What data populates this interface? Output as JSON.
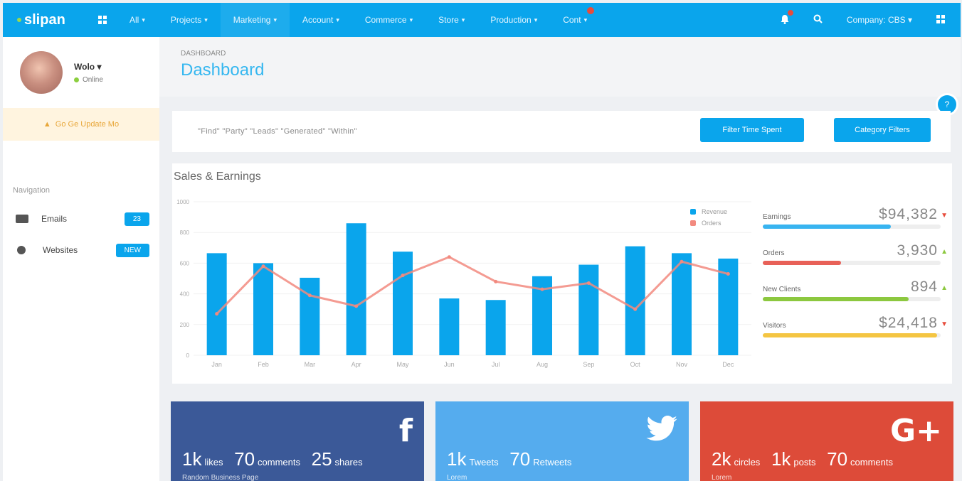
{
  "topbar": {
    "logo": "slipan",
    "menu": [
      {
        "label": "All"
      },
      {
        "label": "Projects"
      },
      {
        "label": "Marketing"
      },
      {
        "label": "Account"
      },
      {
        "label": "Commerce"
      },
      {
        "label": "Store"
      },
      {
        "label": "Production"
      },
      {
        "label": "Cont"
      }
    ],
    "company": "Company: CBS"
  },
  "user": {
    "name": "Wolo",
    "status": "Online"
  },
  "sidebar": {
    "warning": "Go Ge Update Mo",
    "nav_title": "Navigation",
    "items": [
      {
        "label": "Emails",
        "badge": "23"
      },
      {
        "label": "Websites",
        "badge": "NEW"
      }
    ]
  },
  "header": {
    "crumb": "DASHBOARD",
    "title": "Dashboard"
  },
  "filter": {
    "text": "\"Find\" \"Party\" \"Leads\" \"Generated\" \"Within\"",
    "time_button": "Filter Time Spent",
    "category_button": "Category Filters"
  },
  "sales_card": {
    "title": "Sales & Earnings"
  },
  "colors": {
    "primary": "#0aa5ec",
    "orders": "#f28a7f",
    "facebook": "#3b5998",
    "twitter": "#55acee",
    "google": "#dd4b39"
  },
  "chart_data": {
    "type": "bar",
    "categories": [
      "Jan",
      "Feb",
      "Mar",
      "Apr",
      "May",
      "Jun",
      "Jul",
      "Aug",
      "Sep",
      "Oct",
      "Nov",
      "Dec"
    ],
    "series": [
      {
        "name": "Revenue",
        "type": "bar",
        "values": [
          665,
          600,
          505,
          860,
          675,
          370,
          360,
          515,
          590,
          710,
          665,
          630
        ]
      },
      {
        "name": "Orders",
        "type": "line",
        "values": [
          270,
          580,
          390,
          320,
          520,
          640,
          480,
          430,
          470,
          300,
          610,
          530
        ]
      }
    ],
    "yticks": [
      "0",
      "200",
      "400",
      "600",
      "800",
      "1000"
    ],
    "ylim": [
      0,
      1000
    ]
  },
  "stats": [
    {
      "label": "Earnings",
      "value": "$94,382",
      "trend": "down",
      "fill": 0.72,
      "color": "#38b4f0"
    },
    {
      "label": "Orders",
      "value": "3,930",
      "trend": "up",
      "fill": 0.44,
      "color": "#e86158"
    },
    {
      "label": "New Clients",
      "value": "894",
      "trend": "up",
      "fill": 0.82,
      "color": "#8cc83f"
    },
    {
      "label": "Visitors",
      "value": "$24,418",
      "trend": "down",
      "fill": 0.98,
      "color": "#f4c542"
    }
  ],
  "social": {
    "facebook": {
      "likes": "1k",
      "likes_label": "likes",
      "comments": "70",
      "comments_label": "comments",
      "shares": "25",
      "shares_label": "shares",
      "sub": "Random Business Page"
    },
    "twitter": {
      "tweets": "1k",
      "tweets_label": "Tweets",
      "retweets": "70",
      "retweets_label": "Retweets",
      "sub": "Lorem"
    },
    "google": {
      "circles": "2k",
      "circles_label": "circles",
      "posts": "1k",
      "posts_label": "posts",
      "comments": "70",
      "comments_label": "comments",
      "sub": "Lorem"
    }
  }
}
